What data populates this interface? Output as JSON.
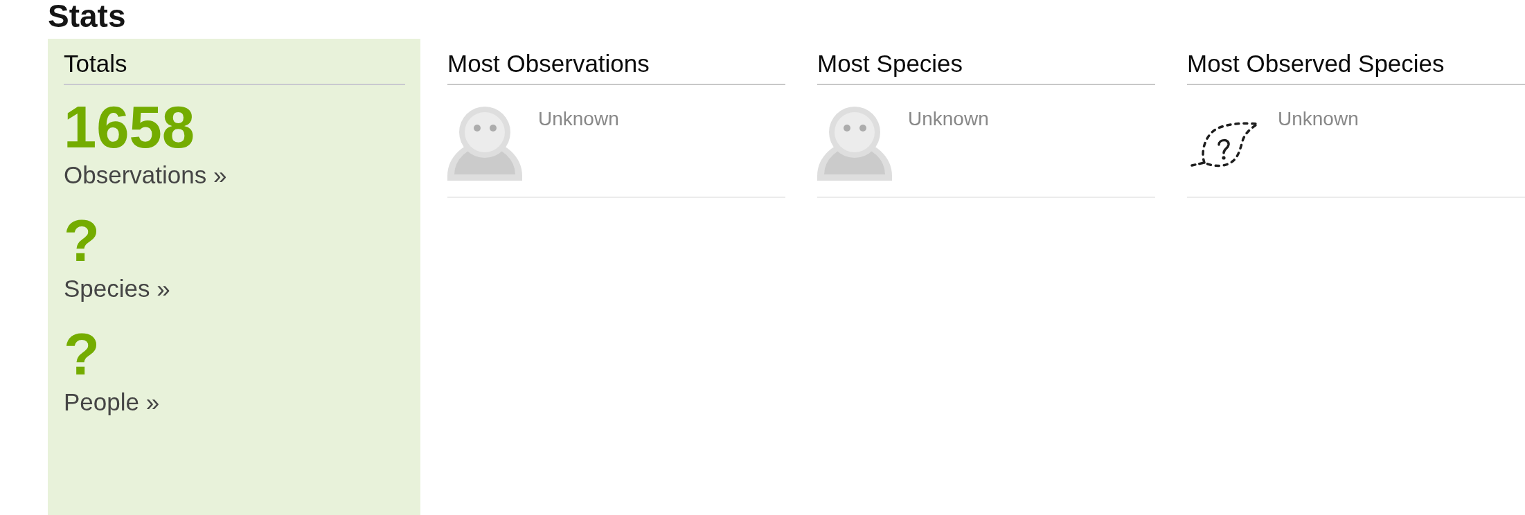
{
  "heading": "Stats",
  "totals": {
    "title": "Totals",
    "stats": [
      {
        "value": "1658",
        "label": "Observations »"
      },
      {
        "value": "?",
        "label": "Species »"
      },
      {
        "value": "?",
        "label": "People »"
      }
    ]
  },
  "leaders": [
    {
      "title": "Most Observations",
      "kind": "person",
      "name": "Unknown"
    },
    {
      "title": "Most Species",
      "kind": "person",
      "name": "Unknown"
    },
    {
      "title": "Most Observed Species",
      "kind": "taxon",
      "name": "Unknown"
    }
  ]
}
